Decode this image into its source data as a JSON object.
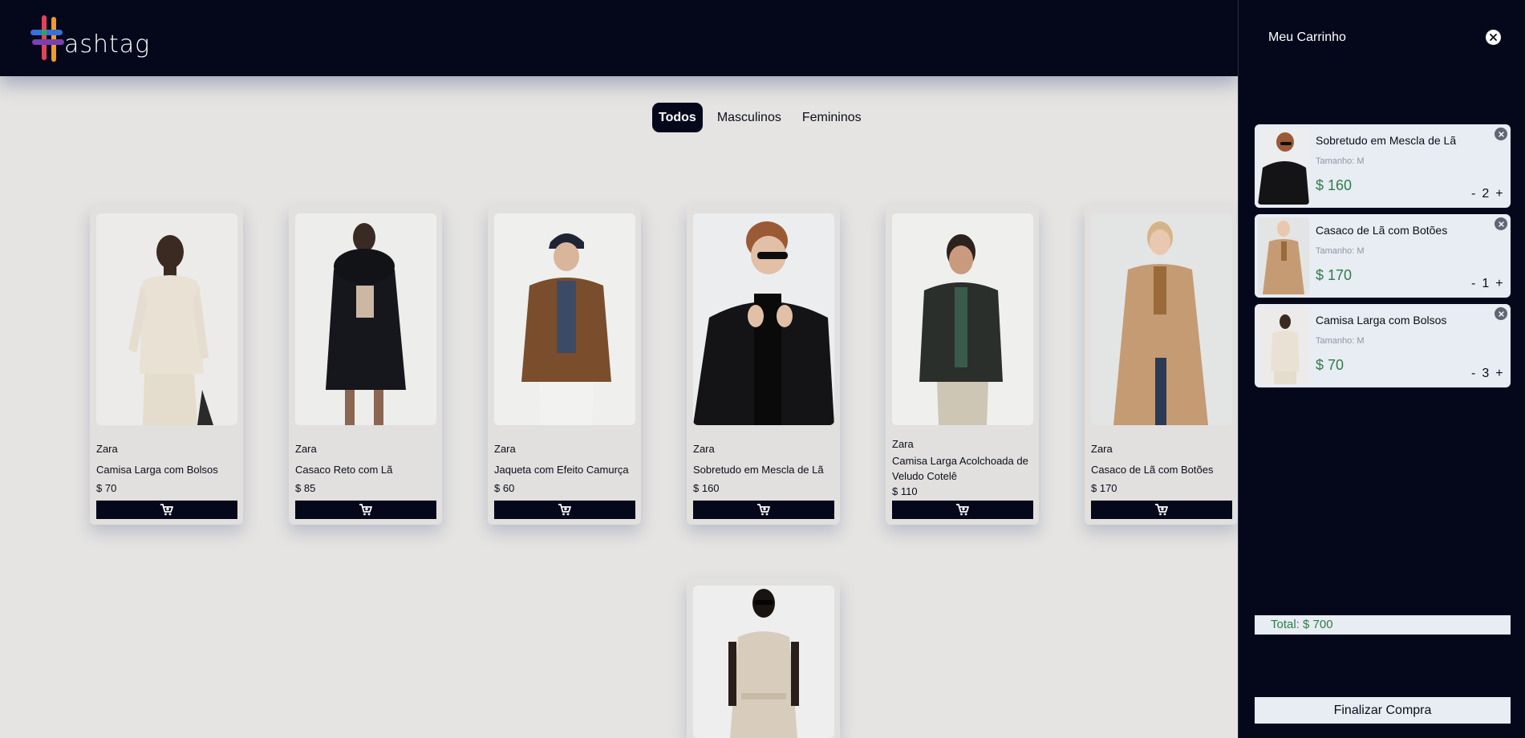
{
  "header": {
    "logo_text": "ashtag"
  },
  "filters": [
    {
      "label": "Todos",
      "active": true
    },
    {
      "label": "Masculinos",
      "active": false
    },
    {
      "label": "Femininos",
      "active": false
    }
  ],
  "products": [
    {
      "brand": "Zara",
      "name": "Camisa Larga com Bolsos",
      "price": "$ 70"
    },
    {
      "brand": "Zara",
      "name": "Casaco Reto com Lã",
      "price": "$ 85"
    },
    {
      "brand": "Zara",
      "name": "Jaqueta com Efeito Camurça",
      "price": "$ 60"
    },
    {
      "brand": "Zara",
      "name": "Sobretudo em Mescla de Lã",
      "price": "$ 160"
    },
    {
      "brand": "Zara",
      "name": "Camisa Larga Acolchoada de Veludo Cotelê",
      "price": "$ 110"
    },
    {
      "brand": "Zara",
      "name": "Casaco de Lã com Botões",
      "price": "$ 170"
    }
  ],
  "cart": {
    "title": "Meu Carrinho",
    "items": [
      {
        "name": "Sobretudo em Mescla de Lã",
        "size": "Tamanho: M",
        "price": "$ 160",
        "minus": "-",
        "qty": "2",
        "plus": "+"
      },
      {
        "name": "Casaco de Lã com Botões",
        "size": "Tamanho: M",
        "price": "$ 170",
        "minus": "-",
        "qty": "1",
        "plus": "+"
      },
      {
        "name": "Camisa Larga com Bolsos",
        "size": "Tamanho: M",
        "price": "$ 70",
        "minus": "-",
        "qty": "3",
        "plus": "+"
      }
    ],
    "total": "Total: $ 700",
    "checkout_label": "Finalizar Compra"
  },
  "icons": {
    "cart": "shopping-cart-icon",
    "close": "close-icon"
  },
  "colors": {
    "navy": "#05081b",
    "page_bg": "#e5e4e2",
    "price_green": "#2e7d46",
    "panel_light": "#e8ecf3"
  }
}
